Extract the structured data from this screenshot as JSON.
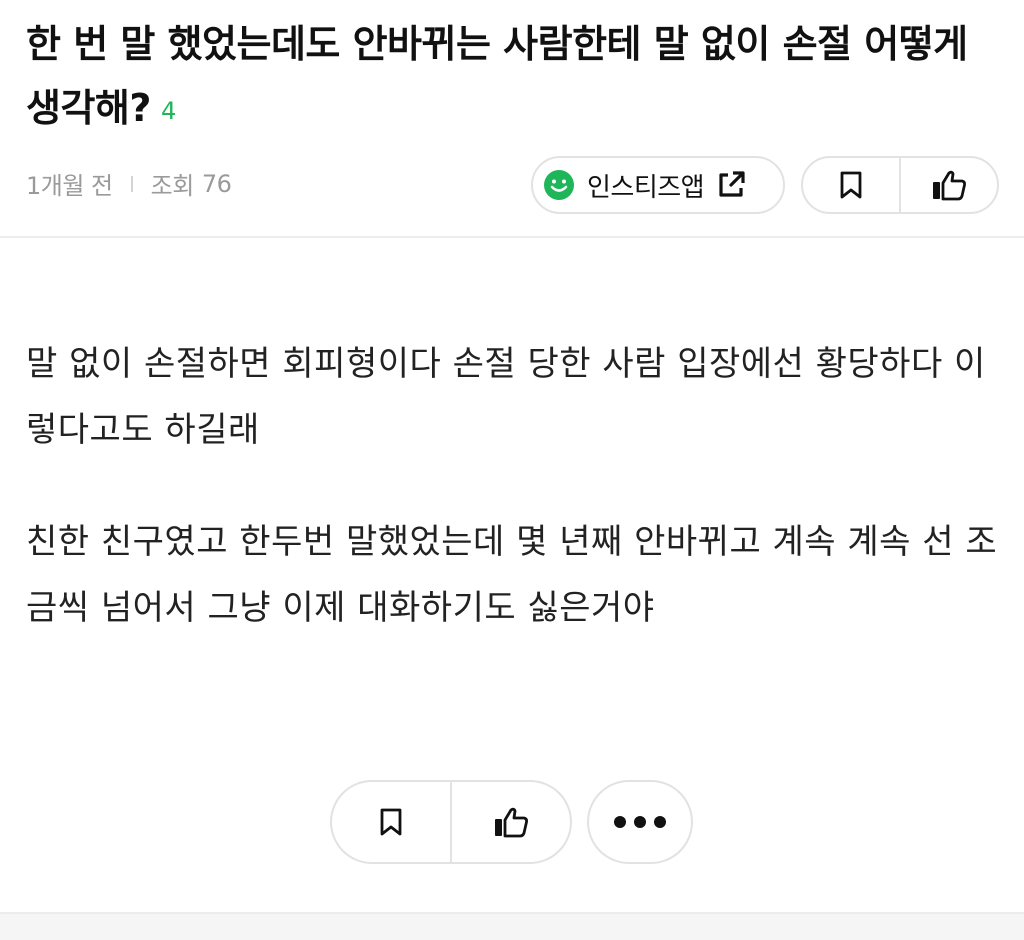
{
  "post": {
    "title": "한 번 말 했었는데도 안바뀌는 사람한테 말 없이 손절 어떻게 생각해?",
    "comment_count": "4",
    "time_ago": "1개월 전",
    "views_label": "조회",
    "views_count": "76",
    "body": [
      "말 없이 손절하면 회피형이다 손절 당한 사람 입장에선 황당하다 이렇다고도 하길래",
      "친한 친구였고 한두번 말했었는데 몇 년째 안바뀌고 계속 계속 선 조금씩 넘어서 그냥 이제 대화하기도 싫은거야"
    ]
  },
  "actions": {
    "app_button_label": "인스티즈앱",
    "icons": {
      "app": "smile-icon",
      "external": "external-link-icon",
      "bookmark": "bookmark-icon",
      "like": "thumbs-up-icon",
      "more": "more-dots-icon"
    }
  },
  "colors": {
    "accent_green": "#1fb659",
    "meta_gray": "#9a9a9a",
    "border": "#e2e2e2"
  }
}
